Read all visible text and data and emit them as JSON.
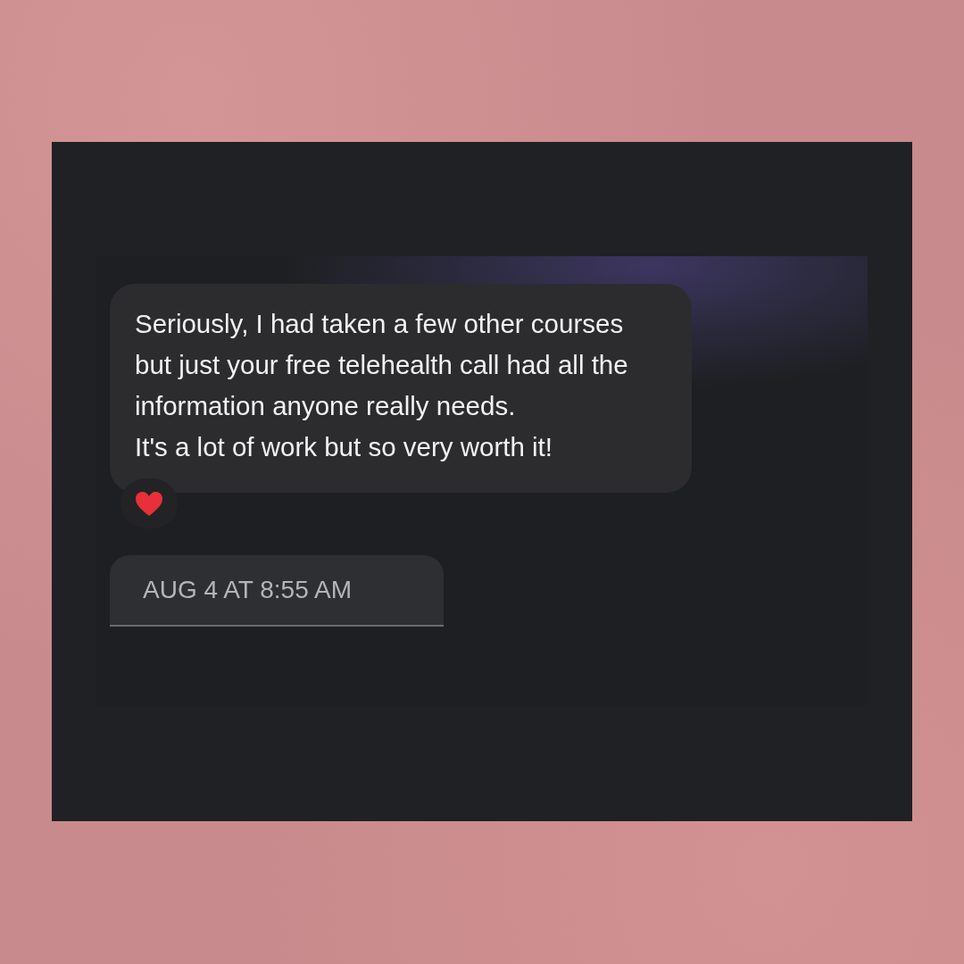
{
  "message": {
    "paragraphs": [
      "Seriously, I had taken a few other courses but just your free telehealth call had all the information anyone really needs.",
      "It's a lot of work but so very worth it!"
    ]
  },
  "timestamp": "AUG 4 AT 8:55 AM"
}
